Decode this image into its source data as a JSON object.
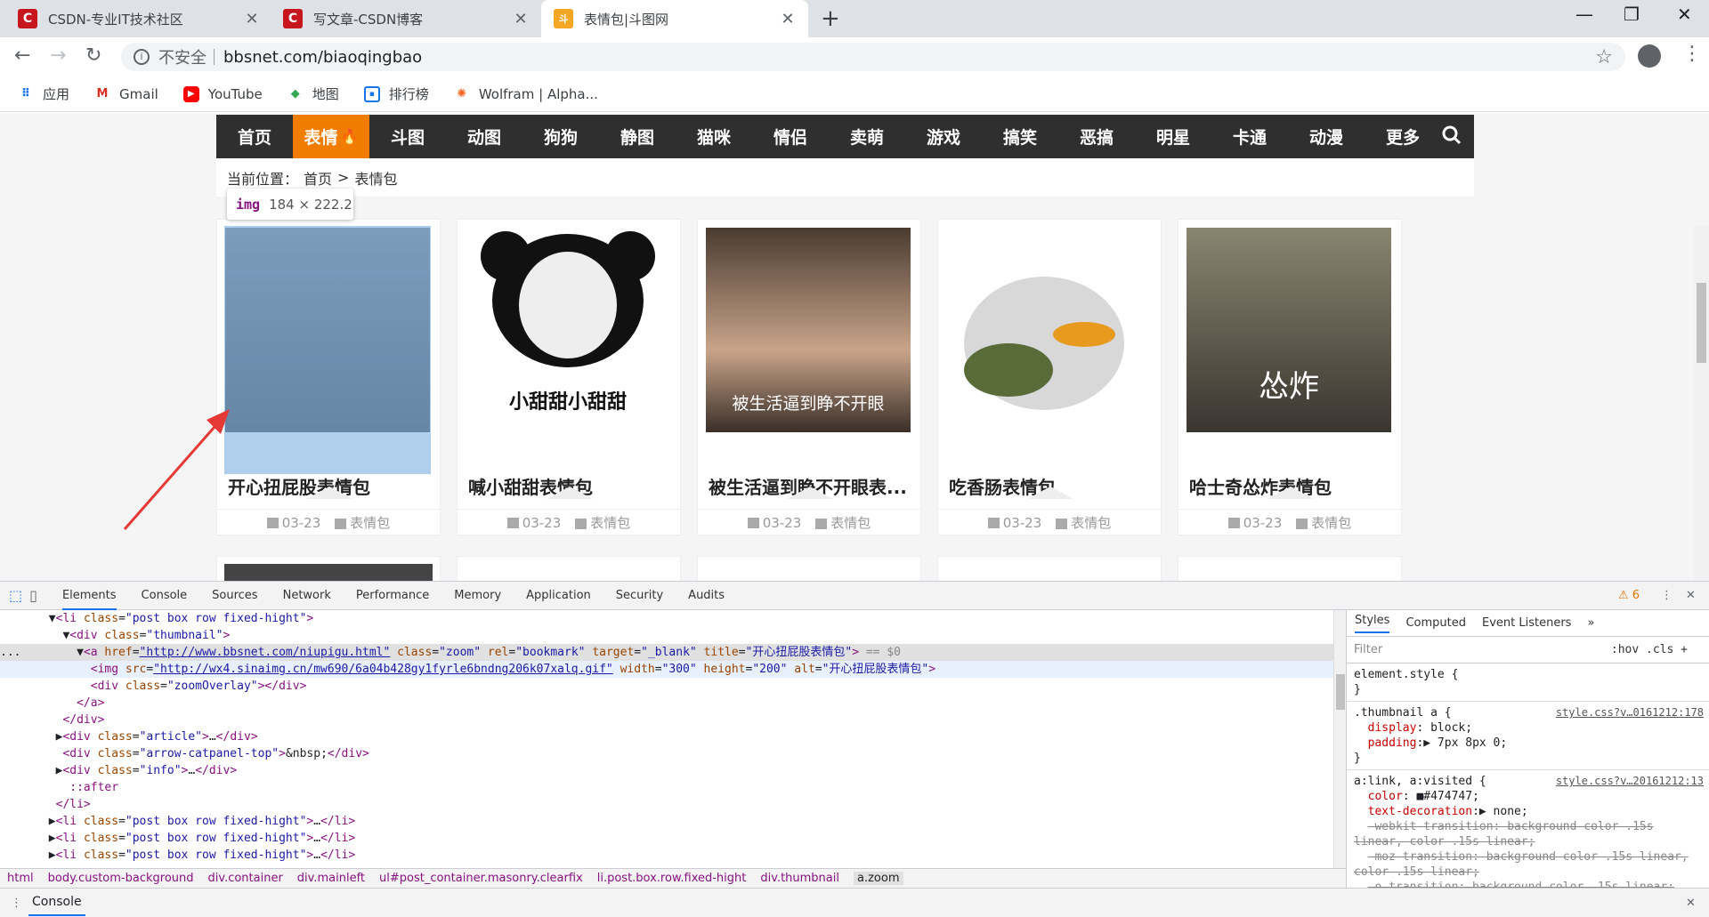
{
  "tabs": [
    {
      "title": "CSDN-专业IT技术社区",
      "icon": "csdn-icon",
      "color": "#c7161e"
    },
    {
      "title": "写文章-CSDN博客",
      "icon": "csdn-icon",
      "color": "#c7161e"
    },
    {
      "title": "表情包|斗图网",
      "icon": "site-icon",
      "color": "#f5a623"
    }
  ],
  "omnibox": {
    "security": "不安全",
    "url": "bbsnet.com/biaoqingbao"
  },
  "bookmarks": [
    {
      "label": "应用",
      "icon": "apps-grid-icon"
    },
    {
      "label": "Gmail",
      "icon": "gmail-icon"
    },
    {
      "label": "YouTube",
      "icon": "youtube-icon"
    },
    {
      "label": "地图",
      "icon": "maps-icon"
    },
    {
      "label": "排行榜",
      "icon": "rank-icon"
    },
    {
      "label": "Wolfram | Alpha...",
      "icon": "wolfram-icon"
    }
  ],
  "site_nav": [
    "首页",
    "表情",
    "斗图",
    "动图",
    "狗狗",
    "静图",
    "猫咪",
    "情侣",
    "卖萌",
    "游戏",
    "搞笑",
    "恶搞",
    "明星",
    "卡通",
    "动漫",
    "更多"
  ],
  "breadcrumb": {
    "label": "当前位置：",
    "home": "首页",
    "sep": ">",
    "current": "表情包"
  },
  "cards": [
    {
      "title": "开心扭屁股表情包",
      "caption": "",
      "date": "03-23",
      "category": "表情包"
    },
    {
      "title": "喊小甜甜表情包",
      "caption": "小甜甜小甜甜",
      "date": "03-23",
      "category": "表情包"
    },
    {
      "title": "被生活逼到睁不开眼表...",
      "caption": "被生活逼到睁不开眼",
      "date": "03-23",
      "category": "表情包"
    },
    {
      "title": "吃香肠表情包",
      "caption": "",
      "date": "03-23",
      "category": "表情包"
    },
    {
      "title": "哈士奇怂炸表情包",
      "caption": "怂炸",
      "date": "03-23",
      "category": "表情包"
    }
  ],
  "tooltip": {
    "tag": "img",
    "dims": "184 × 222.2"
  },
  "devtools": {
    "tabs": [
      "Elements",
      "Console",
      "Sources",
      "Network",
      "Performance",
      "Memory",
      "Application",
      "Security",
      "Audits"
    ],
    "warnings": "6",
    "crumbs": [
      "html",
      "body.custom-background",
      "div.container",
      "div.mainleft",
      "ul#post_container.masonry.clearfix",
      "li.post.box.row.fixed-hight",
      "div.thumbnail",
      "a.zoom"
    ],
    "styles_tabs": [
      "Styles",
      "Computed",
      "Event Listeners"
    ],
    "filter_placeholder": "Filter",
    "filter_right": ":hov  .cls  +",
    "console_label": "Console"
  }
}
